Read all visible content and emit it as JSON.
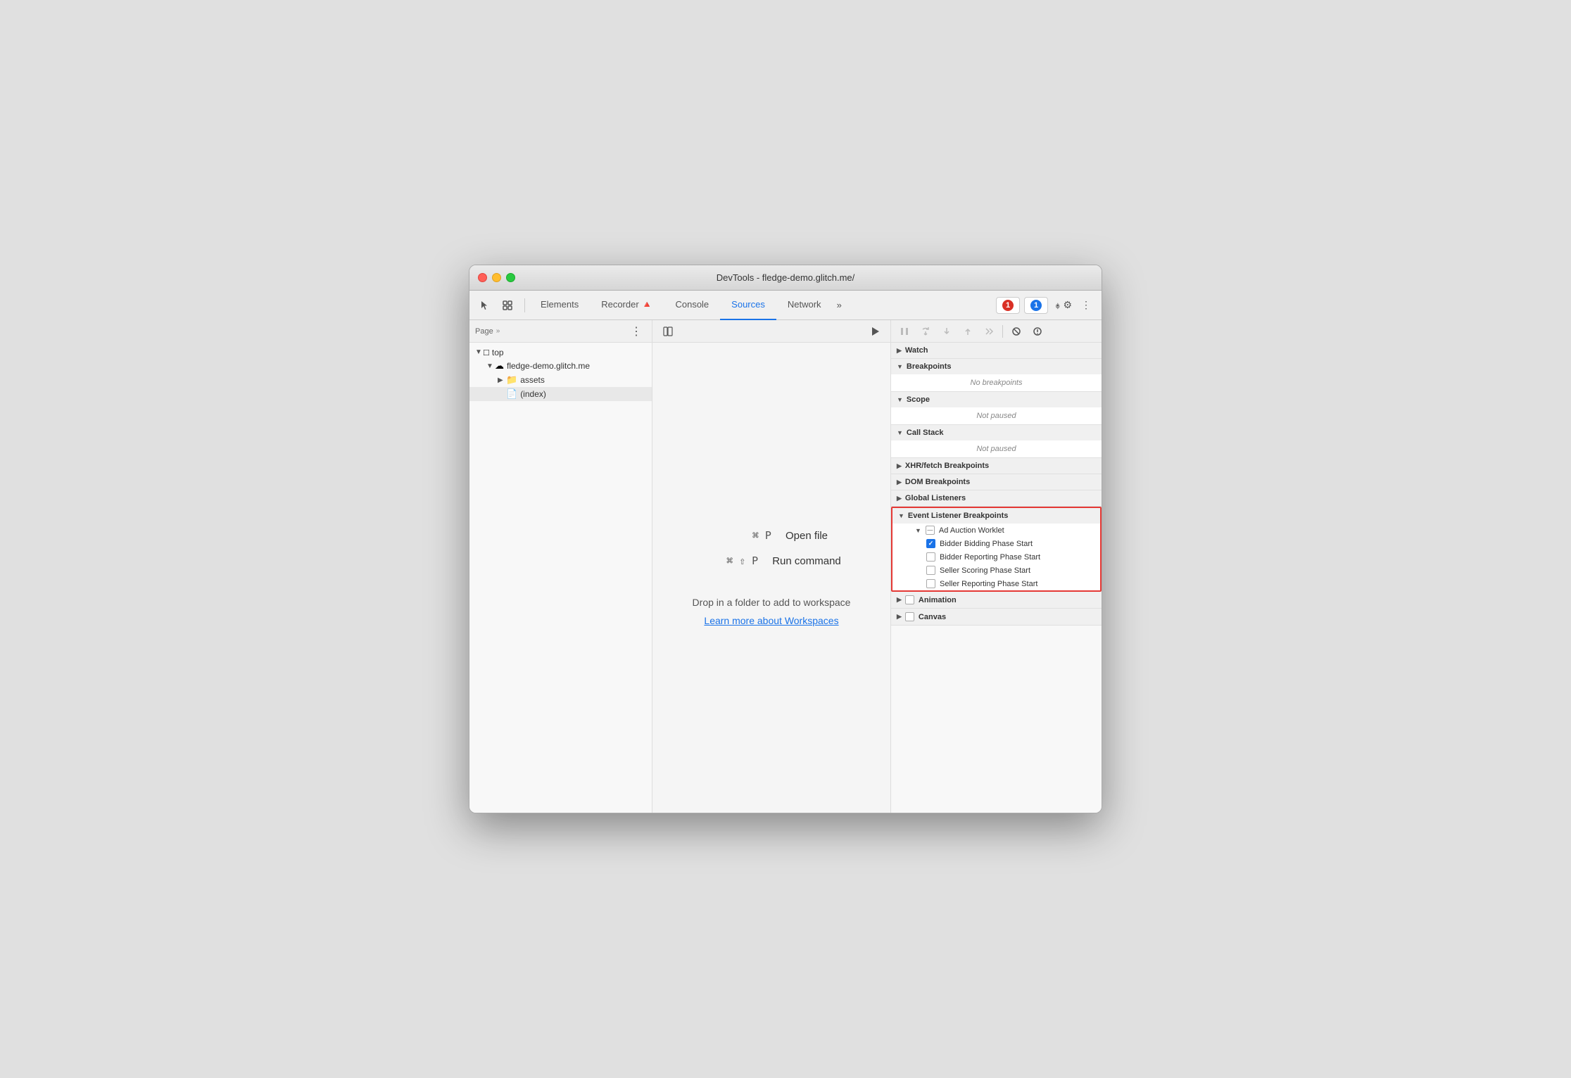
{
  "window": {
    "title": "DevTools - fledge-demo.glitch.me/"
  },
  "toolbar": {
    "tabs": [
      {
        "id": "elements",
        "label": "Elements",
        "active": false
      },
      {
        "id": "recorder",
        "label": "Recorder 🔺",
        "active": false
      },
      {
        "id": "console",
        "label": "Console",
        "active": false
      },
      {
        "id": "sources",
        "label": "Sources",
        "active": true
      },
      {
        "id": "network",
        "label": "Network",
        "active": false
      }
    ],
    "error_badge": "1",
    "info_badge": "1",
    "more_tabs": "»"
  },
  "left_panel": {
    "title": "Page",
    "tree": [
      {
        "level": 0,
        "type": "folder",
        "label": "top",
        "arrow": "▼",
        "expanded": true
      },
      {
        "level": 1,
        "type": "cloud",
        "label": "fledge-demo.glitch.me",
        "arrow": "▼",
        "expanded": true
      },
      {
        "level": 2,
        "type": "folder-blue",
        "label": "assets",
        "arrow": "▶",
        "expanded": false
      },
      {
        "level": 2,
        "type": "file",
        "label": "(index)",
        "selected": true
      }
    ]
  },
  "middle_panel": {
    "shortcut1_key": "⌘ P",
    "shortcut1_desc": "Open file",
    "shortcut2_key": "⌘ ⇧ P",
    "shortcut2_desc": "Run command",
    "drop_text": "Drop in a folder to add to workspace",
    "workspace_link": "Learn more about Workspaces"
  },
  "right_panel": {
    "debug_buttons": [
      "pause",
      "step-over",
      "step-into",
      "step-out",
      "step",
      "deactivate",
      "pause-on-exception"
    ],
    "sections": [
      {
        "id": "watch",
        "label": "Watch",
        "collapsed": true
      },
      {
        "id": "breakpoints",
        "label": "Breakpoints",
        "collapsed": false,
        "body": "No breakpoints"
      },
      {
        "id": "scope",
        "label": "Scope",
        "collapsed": false,
        "body": "Not paused"
      },
      {
        "id": "call-stack",
        "label": "Call Stack",
        "collapsed": false,
        "body": "Not paused"
      },
      {
        "id": "xhr-fetch",
        "label": "XHR/fetch Breakpoints",
        "collapsed": true
      },
      {
        "id": "dom-breakpoints",
        "label": "DOM Breakpoints",
        "collapsed": true
      },
      {
        "id": "global-listeners",
        "label": "Global Listeners",
        "collapsed": true
      }
    ],
    "event_listener_breakpoints": {
      "label": "Event Listener Breakpoints",
      "highlighted": true,
      "groups": [
        {
          "label": "Ad Auction Worklet",
          "expanded": true,
          "partial_check": true,
          "items": [
            {
              "label": "Bidder Bidding Phase Start",
              "checked": true
            },
            {
              "label": "Bidder Reporting Phase Start",
              "checked": false
            },
            {
              "label": "Seller Scoring Phase Start",
              "checked": false
            },
            {
              "label": "Seller Reporting Phase Start",
              "checked": false
            }
          ]
        }
      ],
      "other_groups": [
        {
          "label": "Animation",
          "expanded": false,
          "partial_check": false
        },
        {
          "label": "Canvas",
          "expanded": false,
          "partial_check": false
        }
      ]
    }
  }
}
